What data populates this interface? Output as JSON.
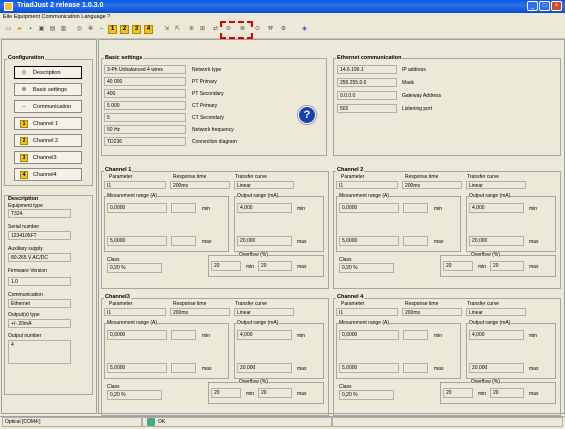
{
  "window": {
    "title": "TriadJust 2      release 1.0.3.0"
  },
  "menu": {
    "equipment": "Eile  Equipment  Communication  Language  ?"
  },
  "toolbar": {
    "nums": [
      "1",
      "2",
      "3",
      "4"
    ]
  },
  "nav": {
    "title": "Configuration",
    "items": [
      {
        "label": "Description",
        "icon": "magnifier-icon",
        "num": ""
      },
      {
        "label": "Basic settings",
        "icon": "gear-icon",
        "num": ""
      },
      {
        "label": "Communication",
        "icon": "link-icon",
        "num": ""
      },
      {
        "label": "Channel 1",
        "icon": "channel-icon",
        "num": "1"
      },
      {
        "label": "Channel 2",
        "icon": "channel-icon",
        "num": "2"
      },
      {
        "label": "Channel3",
        "icon": "channel-icon",
        "num": "3"
      },
      {
        "label": "Channel4",
        "icon": "channel-icon",
        "num": "4"
      }
    ]
  },
  "description": {
    "title": "Description",
    "equipment_type_label": "Equipment type",
    "equipment_type": "T324",
    "serial_label": "Serial number",
    "serial": "1234105FT",
    "aux_label": "Auxiliary supply",
    "aux": "80-265 V AC/DC",
    "fw_label": "Firmware Version",
    "fw": "1.0",
    "comm_label": "Communication",
    "comm": "Ethernet",
    "output_type_label": "Output(s) type",
    "output_type": "+/- 20mA",
    "output_num_label": "Output number",
    "output_num": "4"
  },
  "basic": {
    "title": "Basic settings",
    "rows": [
      {
        "value": "3-Ph Unbalanced 4 wires",
        "label": "Network type"
      },
      {
        "value": "40 000",
        "label": "PT Primary"
      },
      {
        "value": "400",
        "label": "PT Secondary"
      },
      {
        "value": "5 000",
        "label": "CT Primary"
      },
      {
        "value": "5",
        "label": "CT Secondary"
      },
      {
        "value": "50 Hz",
        "label": "Network frequency"
      },
      {
        "value": "TD236",
        "label": "Connection diagram"
      }
    ]
  },
  "ethernet": {
    "title": "Ethernet communication",
    "rows": [
      {
        "value": "14.6.199.1",
        "label": "IP address"
      },
      {
        "value": "255.255.0.0",
        "label": "Mask"
      },
      {
        "value": "0.0.0.0",
        "label": "Gateway Address"
      },
      {
        "value": "502",
        "label": "Listening port"
      }
    ]
  },
  "channel_labels": {
    "parameter": "Parameter",
    "response": "Response time",
    "transfer": "Transfer curve",
    "meas_range": "Mesurement range (A)",
    "out_range": "Output range (mA)",
    "min": "min",
    "max": "max",
    "class": "Class",
    "overflow": "Overflow (%)"
  },
  "channels": [
    {
      "title": "Channel 1",
      "parameter": "I1",
      "response": "200ms",
      "transfer": "Linear",
      "meas_min": "0,0000",
      "meas_max": "5,0000",
      "out_min": "4,000",
      "out_max": "20,000",
      "class": "0,20 %",
      "ovf_min": "20",
      "ovf_max": "20"
    },
    {
      "title": "Channel 2",
      "parameter": "I1",
      "response": "200ms",
      "transfer": "Linear",
      "meas_min": "0,0000",
      "meas_max": "5,0000",
      "out_min": "4,000",
      "out_max": "20,000",
      "class": "0,20 %",
      "ovf_min": "20",
      "ovf_max": "20"
    },
    {
      "title": "Channel3",
      "parameter": "I1",
      "response": "200ms",
      "transfer": "Linear",
      "meas_min": "0,0000",
      "meas_max": "5,0000",
      "out_min": "4,000",
      "out_max": "20,000",
      "class": "0,20 %",
      "ovf_min": "20",
      "ovf_max": "20"
    },
    {
      "title": "Channel 4",
      "parameter": "I1",
      "response": "200ms",
      "transfer": "Linear",
      "meas_min": "0,0000",
      "meas_max": "5,0000",
      "out_min": "4,000",
      "out_max": "20,000",
      "class": "0,20 %",
      "ovf_min": "20",
      "ovf_max": "20"
    }
  ],
  "status": {
    "port": "Optical [COM4:]",
    "state": "OK"
  }
}
